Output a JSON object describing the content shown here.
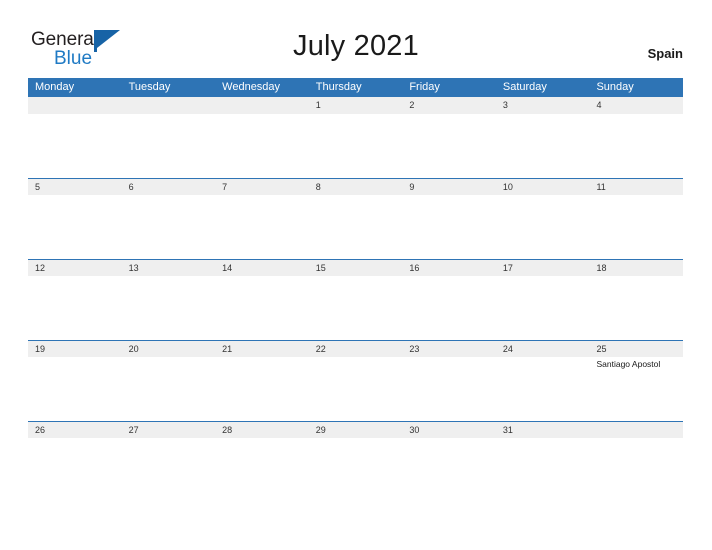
{
  "brand": {
    "name_part1": "General",
    "name_part2": "Blue",
    "flag_icon": "blue-flag-triangle",
    "color_dark": "#231f20",
    "color_blue": "#1f7ac4"
  },
  "header": {
    "title": "July 2021",
    "country": "Spain"
  },
  "colors": {
    "header_blue": "#2e74b5",
    "band_gray": "#efefef",
    "text": "#333333"
  },
  "calendar": {
    "weekday_headers": [
      "Monday",
      "Tuesday",
      "Wednesday",
      "Thursday",
      "Friday",
      "Saturday",
      "Sunday"
    ],
    "weeks": [
      {
        "days": [
          {
            "num": "",
            "event": ""
          },
          {
            "num": "",
            "event": ""
          },
          {
            "num": "",
            "event": ""
          },
          {
            "num": "1",
            "event": ""
          },
          {
            "num": "2",
            "event": ""
          },
          {
            "num": "3",
            "event": ""
          },
          {
            "num": "4",
            "event": ""
          }
        ]
      },
      {
        "days": [
          {
            "num": "5",
            "event": ""
          },
          {
            "num": "6",
            "event": ""
          },
          {
            "num": "7",
            "event": ""
          },
          {
            "num": "8",
            "event": ""
          },
          {
            "num": "9",
            "event": ""
          },
          {
            "num": "10",
            "event": ""
          },
          {
            "num": "11",
            "event": ""
          }
        ]
      },
      {
        "days": [
          {
            "num": "12",
            "event": ""
          },
          {
            "num": "13",
            "event": ""
          },
          {
            "num": "14",
            "event": ""
          },
          {
            "num": "15",
            "event": ""
          },
          {
            "num": "16",
            "event": ""
          },
          {
            "num": "17",
            "event": ""
          },
          {
            "num": "18",
            "event": ""
          }
        ]
      },
      {
        "days": [
          {
            "num": "19",
            "event": ""
          },
          {
            "num": "20",
            "event": ""
          },
          {
            "num": "21",
            "event": ""
          },
          {
            "num": "22",
            "event": ""
          },
          {
            "num": "23",
            "event": ""
          },
          {
            "num": "24",
            "event": ""
          },
          {
            "num": "25",
            "event": "Santiago Apostol"
          }
        ]
      },
      {
        "days": [
          {
            "num": "26",
            "event": ""
          },
          {
            "num": "27",
            "event": ""
          },
          {
            "num": "28",
            "event": ""
          },
          {
            "num": "29",
            "event": ""
          },
          {
            "num": "30",
            "event": ""
          },
          {
            "num": "31",
            "event": ""
          },
          {
            "num": "",
            "event": ""
          }
        ]
      }
    ]
  }
}
